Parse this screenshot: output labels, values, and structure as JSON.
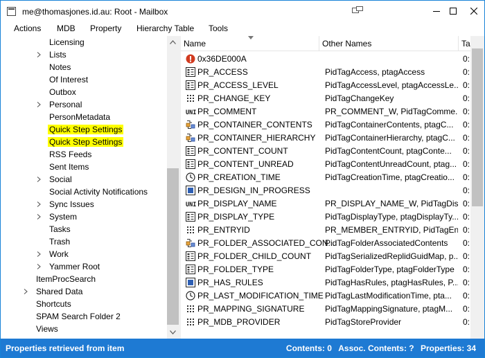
{
  "window": {
    "title": "me@thomasjones.id.au: Root - Mailbox"
  },
  "menu": [
    "Actions",
    "MDB",
    "Property",
    "Hierarchy Table",
    "Tools"
  ],
  "tree": {
    "items": [
      {
        "label": "Licensing",
        "expander": false,
        "highlight": false
      },
      {
        "label": "Lists",
        "expander": true,
        "highlight": false
      },
      {
        "label": "Notes",
        "expander": false,
        "highlight": false
      },
      {
        "label": "Of Interest",
        "expander": false,
        "highlight": false
      },
      {
        "label": "Outbox",
        "expander": false,
        "highlight": false
      },
      {
        "label": "Personal",
        "expander": true,
        "highlight": false
      },
      {
        "label": "PersonMetadata",
        "expander": false,
        "highlight": false
      },
      {
        "label": "Quick Step Settings",
        "expander": false,
        "highlight": true
      },
      {
        "label": "Quick Step Settings",
        "expander": false,
        "highlight": true
      },
      {
        "label": "RSS Feeds",
        "expander": false,
        "highlight": false
      },
      {
        "label": "Sent Items",
        "expander": false,
        "highlight": false
      },
      {
        "label": "Social",
        "expander": true,
        "highlight": false
      },
      {
        "label": "Social Activity Notifications",
        "expander": false,
        "highlight": false
      },
      {
        "label": "Sync Issues",
        "expander": true,
        "highlight": false
      },
      {
        "label": "System",
        "expander": true,
        "highlight": false
      },
      {
        "label": "Tasks",
        "expander": false,
        "highlight": false
      },
      {
        "label": "Trash",
        "expander": false,
        "highlight": false
      },
      {
        "label": "Work",
        "expander": true,
        "highlight": false
      },
      {
        "label": "Yammer Root",
        "expander": true,
        "highlight": false
      },
      {
        "label": "ItemProcSearch",
        "expander": false,
        "highlight": false,
        "level": 1
      },
      {
        "label": "Shared Data",
        "expander": true,
        "highlight": false,
        "level": 1
      },
      {
        "label": "Shortcuts",
        "expander": false,
        "highlight": false,
        "level": 1
      },
      {
        "label": "SPAM Search Folder 2",
        "expander": false,
        "highlight": false,
        "level": 1
      },
      {
        "label": "Views",
        "expander": false,
        "highlight": false,
        "level": 1
      }
    ]
  },
  "columns": {
    "name": "Name",
    "other_names": "Other Names",
    "third": "Ta"
  },
  "rows": [
    {
      "icon": "error-icon",
      "name": "0x36DE000A",
      "other": "",
      "third": "0:"
    },
    {
      "icon": "access-icon",
      "name": "PR_ACCESS",
      "other": "PidTagAccess, ptagAccess",
      "third": "0:"
    },
    {
      "icon": "access-icon",
      "name": "PR_ACCESS_LEVEL",
      "other": "PidTagAccessLevel, ptagAccessLe...",
      "third": "0:"
    },
    {
      "icon": "binary-icon",
      "name": "PR_CHANGE_KEY",
      "other": "PidTagChangeKey",
      "third": "0:"
    },
    {
      "icon": "unicode-icon",
      "name": "PR_COMMENT",
      "other": "PR_COMMENT_W, PidTagComme...",
      "third": "0:"
    },
    {
      "icon": "container-icon",
      "name": "PR_CONTAINER_CONTENTS",
      "other": "PidTagContainerContents, ptagC...",
      "third": "0:"
    },
    {
      "icon": "container-icon",
      "name": "PR_CONTAINER_HIERARCHY",
      "other": "PidTagContainerHierarchy, ptagC...",
      "third": "0:"
    },
    {
      "icon": "access-icon",
      "name": "PR_CONTENT_COUNT",
      "other": "PidTagContentCount, ptagConte...",
      "third": "0:"
    },
    {
      "icon": "access-icon",
      "name": "PR_CONTENT_UNREAD",
      "other": "PidTagContentUnreadCount, ptag...",
      "third": "0:"
    },
    {
      "icon": "clock-icon",
      "name": "PR_CREATION_TIME",
      "other": "PidTagCreationTime, ptagCreatio...",
      "third": "0:"
    },
    {
      "icon": "bool-icon",
      "name": "PR_DESIGN_IN_PROGRESS",
      "other": "",
      "third": "0:"
    },
    {
      "icon": "unicode-icon",
      "name": "PR_DISPLAY_NAME",
      "other": "PR_DISPLAY_NAME_W, PidTagDis...",
      "third": "0:"
    },
    {
      "icon": "access-icon",
      "name": "PR_DISPLAY_TYPE",
      "other": "PidTagDisplayType, ptagDisplayTy...",
      "third": "0:"
    },
    {
      "icon": "binary-icon",
      "name": "PR_ENTRYID",
      "other": "PR_MEMBER_ENTRYID, PidTagEnt...",
      "third": "0:"
    },
    {
      "icon": "container-icon",
      "name": "PR_FOLDER_ASSOCIATED_CON...",
      "other": "PidTagFolderAssociatedContents",
      "third": "0:"
    },
    {
      "icon": "access-icon",
      "name": "PR_FOLDER_CHILD_COUNT",
      "other": "PidTagSerializedReplidGuidMap, p...",
      "third": "0:"
    },
    {
      "icon": "access-icon",
      "name": "PR_FOLDER_TYPE",
      "other": "PidTagFolderType, ptagFolderType",
      "third": "0:"
    },
    {
      "icon": "bool-icon",
      "name": "PR_HAS_RULES",
      "other": "PidTagHasRules, ptagHasRules, P...",
      "third": "0:"
    },
    {
      "icon": "clock-icon",
      "name": "PR_LAST_MODIFICATION_TIME",
      "other": "PidTagLastModificationTime, pta...",
      "third": "0:"
    },
    {
      "icon": "binary-icon",
      "name": "PR_MAPPING_SIGNATURE",
      "other": "PidTagMappingSignature, ptagM...",
      "third": "0:"
    },
    {
      "icon": "binary-icon",
      "name": "PR_MDB_PROVIDER",
      "other": "PidTagStoreProvider",
      "third": "0:"
    }
  ],
  "status": {
    "left": "Properties retrieved from item",
    "contents": "Contents: 0",
    "assoc": "Assoc. Contents: ?",
    "properties": "Properties: 34"
  },
  "colors": {
    "highlight": "#ffff00",
    "statusbar": "#1e7ad3",
    "window_border": "#1883d7"
  }
}
